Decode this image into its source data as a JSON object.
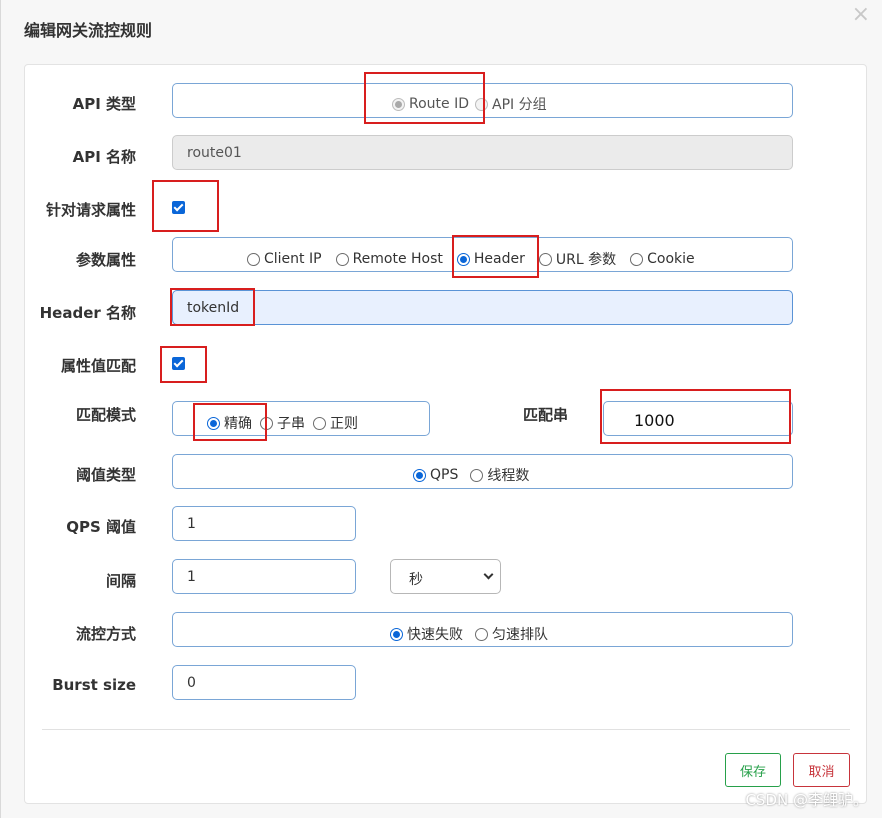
{
  "dialog": {
    "title": "编辑网关流控规则",
    "close_label": "×"
  },
  "form": {
    "api_type": {
      "label": "API 类型",
      "options": [
        {
          "label": "Route ID",
          "checked": true,
          "disabled": true
        },
        {
          "label": "API 分组",
          "checked": false,
          "disabled": true
        }
      ]
    },
    "api_name": {
      "label": "API 名称",
      "value": "route01"
    },
    "request_attr": {
      "label": "针对请求属性",
      "checked": true
    },
    "param_attr": {
      "label": "参数属性",
      "options": [
        {
          "label": "Client IP",
          "checked": false
        },
        {
          "label": "Remote Host",
          "checked": false
        },
        {
          "label": "Header",
          "checked": true
        },
        {
          "label": "URL 参数",
          "checked": false
        },
        {
          "label": "Cookie",
          "checked": false
        }
      ]
    },
    "header_name": {
      "label": "Header 名称",
      "value": "tokenId"
    },
    "attr_match": {
      "label": "属性值匹配",
      "checked": true
    },
    "match_mode": {
      "label": "匹配模式",
      "options": [
        {
          "label": "精确",
          "checked": true
        },
        {
          "label": "子串",
          "checked": false
        },
        {
          "label": "正则",
          "checked": false
        }
      ]
    },
    "match_string": {
      "label": "匹配串",
      "value": "1000"
    },
    "threshold_type": {
      "label": "阈值类型",
      "options": [
        {
          "label": "QPS",
          "checked": true
        },
        {
          "label": "线程数",
          "checked": false
        }
      ]
    },
    "qps_threshold": {
      "label": "QPS 阈值",
      "value": "1"
    },
    "interval": {
      "label": "间隔",
      "value": "1",
      "unit": "秒"
    },
    "control_behavior": {
      "label": "流控方式",
      "options": [
        {
          "label": "快速失败",
          "checked": true
        },
        {
          "label": "匀速排队",
          "checked": false
        }
      ]
    },
    "burst_size": {
      "label": "Burst size",
      "value": "0"
    }
  },
  "footer": {
    "save_label": "保存",
    "cancel_label": "取消"
  },
  "watermark": "CSDN @李鲤驴。",
  "colors": {
    "accent": "#0a66d8",
    "highlight_box": "#d81e1e",
    "save": "#27a04a",
    "cancel": "#c7343b"
  }
}
